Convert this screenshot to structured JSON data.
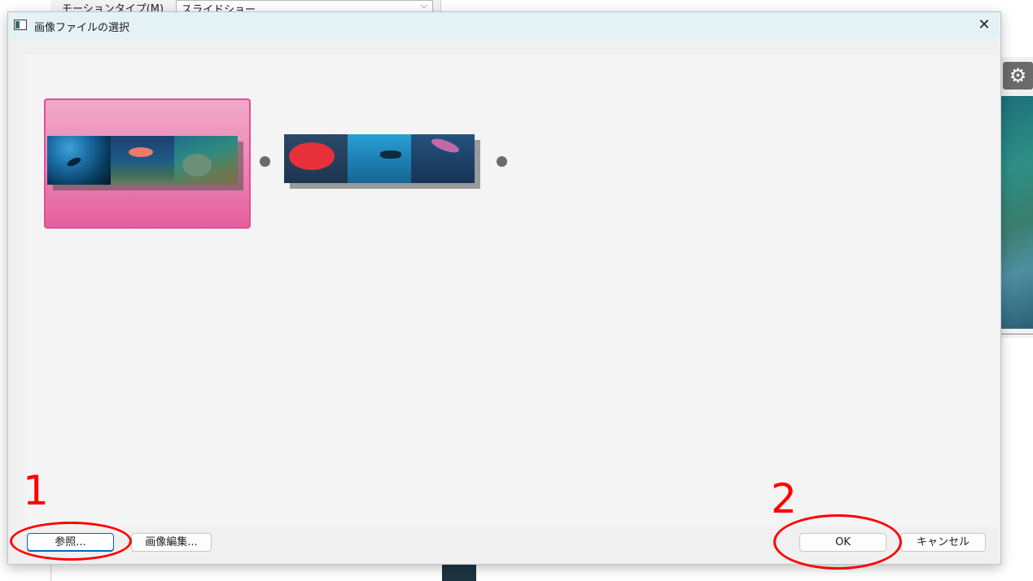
{
  "background": {
    "motion_type_label": "モーションタイプ(M)",
    "motion_type_value": "スライドショー"
  },
  "dialog": {
    "title": "画像ファイルの選択",
    "close_symbol": "✕"
  },
  "slots": [
    {
      "selected": true,
      "photos": [
        "underwater-diver",
        "anthias-fish",
        "sea-turtle"
      ]
    },
    {
      "selected": false,
      "photos": [
        "red-grouper",
        "turtle-and-diver",
        "squid"
      ]
    }
  ],
  "buttons": {
    "browse": "参照...",
    "edit_image": "画像編集...",
    "ok": "OK",
    "cancel": "キャンセル"
  },
  "annotations": {
    "step1": "1",
    "step2": "2",
    "color": "#ff0000"
  },
  "colors": {
    "selected_slot": "#e4609d",
    "focus_border": "#0067c0"
  }
}
